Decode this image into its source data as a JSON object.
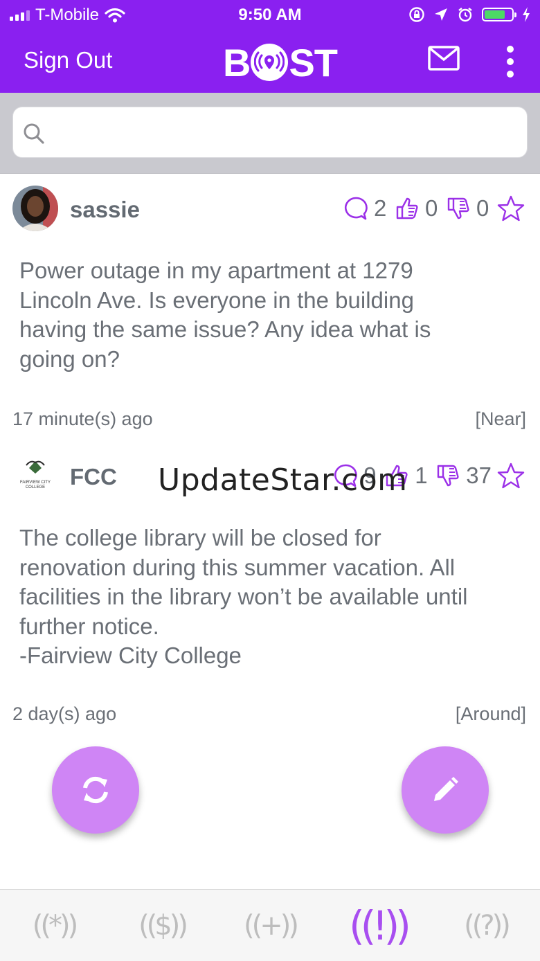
{
  "status_bar": {
    "carrier": "T-Mobile",
    "time": "9:50 AM",
    "battery_color": "#4cd964"
  },
  "header": {
    "sign_out_label": "Sign Out",
    "logo_text_left": "B",
    "logo_text_right": "ST",
    "mail_icon": "mail-icon",
    "menu_icon": "kebab-menu-icon",
    "background": "#8a20f0"
  },
  "search": {
    "placeholder": "",
    "value": ""
  },
  "posts": [
    {
      "username": "sassie",
      "comments": "2",
      "likes": "0",
      "dislikes": "0",
      "body": "Power outage in my apartment at 1279\nLincoln Ave. Is everyone in the building\nhaving the same issue? Any idea what is\ngoing on?",
      "time": "17 minute(s) ago",
      "tag": "[Near]"
    },
    {
      "username": "FCC",
      "avatar_text": "FAIRVIEW CITY COLLEGE",
      "comments": "9",
      "likes": "1",
      "dislikes": "37",
      "body": "The college library will be closed for\nrenovation during this summer vacation. All\nfacilities in the library won’t be available until\nfurther notice.\n-Fairview City College",
      "time": "2 day(s) ago",
      "tag": "[Around]"
    }
  ],
  "watermark": "UpdateStar.com",
  "tabs": [
    {
      "name": "tab-general",
      "glyph": "((*))",
      "active": false
    },
    {
      "name": "tab-money",
      "glyph": "(($))",
      "active": false
    },
    {
      "name": "tab-add",
      "glyph": "((+))",
      "active": false
    },
    {
      "name": "tab-alert",
      "glyph": "((!))",
      "active": true
    },
    {
      "name": "tab-question",
      "glyph": "((?))",
      "active": false
    }
  ],
  "colors": {
    "accent": "#8a20f0",
    "fab": "#cf85f5",
    "icon_purple": "#9b30e8",
    "text_gray": "#6a6f76"
  }
}
